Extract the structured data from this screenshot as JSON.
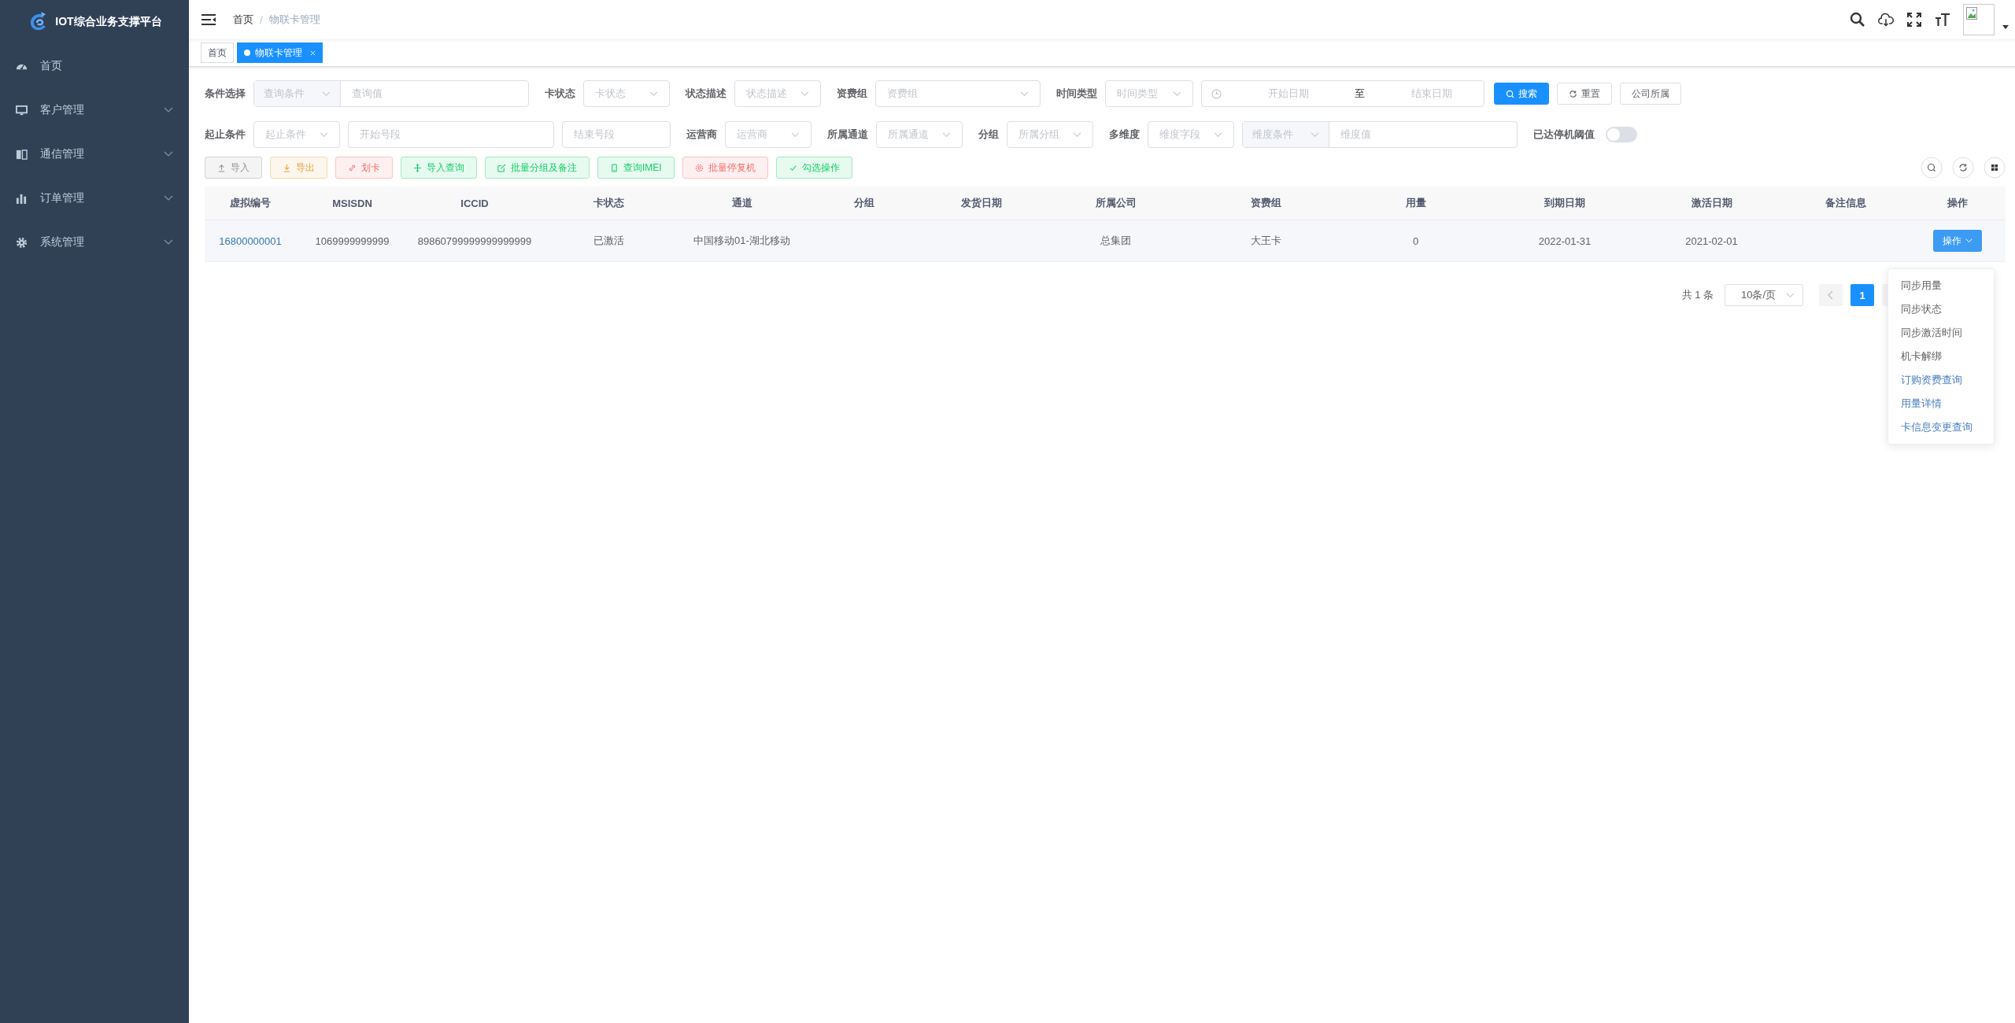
{
  "sidebar": {
    "title": "IOT综合业务支撑平台",
    "items": [
      {
        "label": "首页",
        "kind": "link"
      },
      {
        "label": "客户管理",
        "kind": "submenu",
        "expanded": false
      },
      {
        "label": "通信管理",
        "kind": "submenu",
        "expanded": false
      },
      {
        "label": "订单管理",
        "kind": "submenu",
        "expanded": false
      },
      {
        "label": "系统管理",
        "kind": "submenu",
        "expanded": false
      }
    ]
  },
  "breadcrumb": {
    "separator": "/",
    "items": [
      "首页",
      "物联卡管理"
    ]
  },
  "tags": [
    {
      "label": "首页",
      "selected": false
    },
    {
      "label": "物联卡管理",
      "selected": true
    }
  ],
  "filters": [
    [
      {
        "label": "条件选择",
        "kind": "compound",
        "select": "查询条件",
        "placeholder": "查询值"
      },
      {
        "label": "卡状态",
        "kind": "select",
        "placeholder": "卡状态"
      },
      {
        "label": "状态描述",
        "kind": "select",
        "placeholder": "状态描述"
      },
      {
        "label": "资费组",
        "kind": "select",
        "placeholder": "资费组"
      },
      {
        "label": "时间类型",
        "kind": "select",
        "placeholder": "时间类型"
      },
      {
        "kind": "daterange",
        "start": "开始日期",
        "separator": "至",
        "end": "结束日期"
      },
      {
        "kind": "search",
        "text": "搜索"
      },
      {
        "kind": "reset",
        "text": "重置"
      },
      {
        "kind": "plain",
        "text": "公司所属"
      }
    ],
    [
      {
        "label": "起止条件",
        "kind": "select",
        "placeholder": "起止条件"
      },
      {
        "kind": "input",
        "placeholder": "开始号段"
      },
      {
        "kind": "input",
        "placeholder": "结束号段"
      },
      {
        "label": "运营商",
        "kind": "select",
        "placeholder": "运营商"
      },
      {
        "label": "所属通道",
        "kind": "select",
        "placeholder": "所属通道"
      },
      {
        "label": "分组",
        "kind": "select",
        "placeholder": "所属分组"
      },
      {
        "label": "多维度",
        "kind": "select",
        "placeholder": "维度字段"
      },
      {
        "kind": "compound",
        "select": "维度条件",
        "placeholder": "维度值"
      },
      {
        "label": "已达停机阈值",
        "kind": "switch",
        "on": false
      }
    ]
  ],
  "actions": [
    {
      "label": "导入",
      "kind": "info"
    },
    {
      "label": "导出",
      "kind": "warning"
    },
    {
      "label": "划卡",
      "kind": "danger"
    },
    {
      "label": "导入查询",
      "kind": "success"
    },
    {
      "label": "批量分组及备注",
      "kind": "success"
    },
    {
      "label": "查询IMEI",
      "kind": "success"
    },
    {
      "label": "批量停复机",
      "kind": "danger"
    },
    {
      "label": "勾选操作",
      "kind": "success"
    }
  ],
  "table": {
    "columns": [
      "虚拟编号",
      "MSISDN",
      "ICCID",
      "卡状态",
      "通道",
      "分组",
      "发货日期",
      "所属公司",
      "资费组",
      "用量",
      "到期日期",
      "激活日期",
      "备注信息",
      "操作"
    ],
    "rows": [
      {
        "cells": [
          "16800000001",
          "1069999999999",
          "89860799999999999999",
          "已激活",
          "中国移动01-湖北移动",
          "",
          "",
          "总集团",
          "大王卡",
          "0",
          "2022-01-31",
          "2021-02-01",
          ""
        ],
        "action": "操作"
      }
    ]
  },
  "pagination": {
    "total": "共 1 条",
    "page_size": "10条/页",
    "pages": [
      {
        "label": "1",
        "selected": true
      }
    ]
  },
  "menu": [
    {
      "label": "同步用量",
      "kind": "plain"
    },
    {
      "label": "同步状态",
      "kind": "plain"
    },
    {
      "label": "同步激活时间",
      "kind": "plain"
    },
    {
      "label": "机卡解绑",
      "kind": "plain"
    },
    {
      "label": "订购资费查询",
      "kind": "link"
    },
    {
      "label": "用量详情",
      "kind": "link"
    },
    {
      "label": "卡信息变更查询",
      "kind": "link"
    }
  ]
}
